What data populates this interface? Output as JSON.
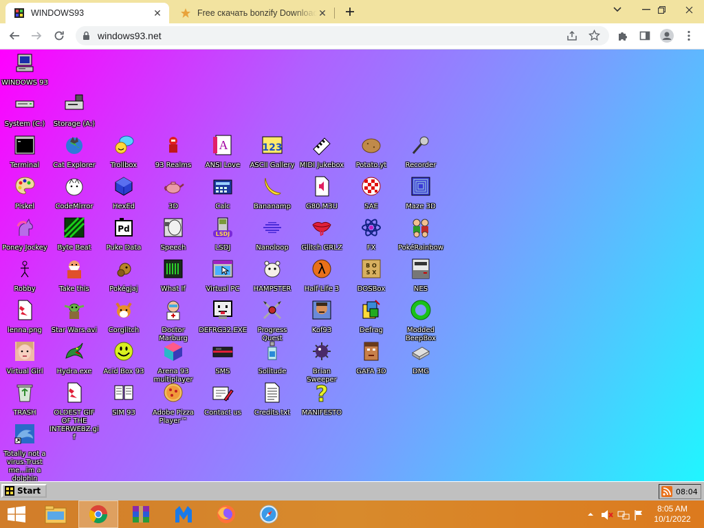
{
  "browser": {
    "tabs": [
      {
        "title": "WINDOWS93",
        "active": true
      },
      {
        "title": "Free скачать bonzify Download",
        "active": false
      }
    ],
    "url": "windows93.net"
  },
  "desktop": {
    "icons": [
      {
        "label": "WINDOWS 93",
        "icon": "computer-icon"
      },
      {
        "label": "System (C:)",
        "icon": "drive-icon"
      },
      {
        "label": "Storage (A:)",
        "icon": "floppy-drive-icon"
      },
      {
        "label": "Terminal",
        "icon": "terminal-icon"
      },
      {
        "label": "Cat Explorer",
        "icon": "cat-globe-icon"
      },
      {
        "label": "Trollbox",
        "icon": "chat-bubble-icon"
      },
      {
        "label": "93 Realms",
        "icon": "red-knight-icon"
      },
      {
        "label": "ANSI Love",
        "icon": "ansi-letter-icon"
      },
      {
        "label": "ASCII Gallery",
        "icon": "ascii-numbers-icon"
      },
      {
        "label": "MIDI Jukebox",
        "icon": "piano-keys-icon"
      },
      {
        "label": "Potato.yt",
        "icon": "potato-icon"
      },
      {
        "label": "Recorder",
        "icon": "microphone-icon"
      },
      {
        "label": "Piskel",
        "icon": "paint-palette-icon"
      },
      {
        "label": "CodeMirror",
        "icon": "code-cat-icon"
      },
      {
        "label": "HexEd",
        "icon": "blue-cube-icon"
      },
      {
        "label": "3D",
        "icon": "teapot-icon"
      },
      {
        "label": "Calc",
        "icon": "calculator-icon"
      },
      {
        "label": "Bananamp",
        "icon": "banana-icon"
      },
      {
        "label": "G80.M3U",
        "icon": "audio-file-icon"
      },
      {
        "label": "SAE",
        "icon": "amiga-ball-icon"
      },
      {
        "label": "Maze 3D",
        "icon": "maze-icon"
      },
      {
        "label": "Poney Jockey",
        "icon": "pony-icon"
      },
      {
        "label": "Byte Beat",
        "icon": "waveform-icon"
      },
      {
        "label": "Puke Data",
        "icon": "pd-icon"
      },
      {
        "label": "Speech",
        "icon": "face-speech-icon"
      },
      {
        "label": "LSDJ",
        "icon": "gameboy-icon"
      },
      {
        "label": "Nanoloop",
        "icon": "loop-wave-icon"
      },
      {
        "label": "Glitch GRLZ",
        "icon": "lips-icon"
      },
      {
        "label": "FX",
        "icon": "atom-icon"
      },
      {
        "label": "PokéRainbow",
        "icon": "trainers-icon"
      },
      {
        "label": "Robby",
        "icon": "stick-figure-icon"
      },
      {
        "label": "Take this",
        "icon": "old-man-icon"
      },
      {
        "label": "Pokégjaj",
        "icon": "pokemon-icon"
      },
      {
        "label": "What If",
        "icon": "film-strip-icon"
      },
      {
        "label": "Virtual PC",
        "icon": "window-cursor-icon"
      },
      {
        "label": "HAMPSTER",
        "icon": "hamster-icon"
      },
      {
        "label": "Half-Life 3",
        "icon": "lambda-icon"
      },
      {
        "label": "DOSBox",
        "icon": "dosbox-icon"
      },
      {
        "label": "NES",
        "icon": "nes-console-icon"
      },
      {
        "label": "lenna.png",
        "icon": "image-file-icon"
      },
      {
        "label": "Star Wars.avi",
        "icon": "yoda-icon"
      },
      {
        "label": "Corglitch",
        "icon": "corgi-icon"
      },
      {
        "label": "Doctor Marburg",
        "icon": "doctor-icon"
      },
      {
        "label": "DEFRG32.EXE",
        "icon": "monitor-face-icon"
      },
      {
        "label": "Progress Quest",
        "icon": "crossed-swords-icon"
      },
      {
        "label": "Kof93",
        "icon": "fighter-icon"
      },
      {
        "label": "Defrag",
        "icon": "defrag-icon"
      },
      {
        "label": "Modded BeepBox",
        "icon": "green-ring-icon"
      },
      {
        "label": "Virtual Girl",
        "icon": "girl-face-icon"
      },
      {
        "label": "Hydra.exe",
        "icon": "dragon-icon"
      },
      {
        "label": "Acid Box 93",
        "icon": "smiley-icon"
      },
      {
        "label": "Arena 93 multiplayer",
        "icon": "colored-cube-icon"
      },
      {
        "label": "SMS",
        "icon": "sega-console-icon"
      },
      {
        "label": "Solitude",
        "icon": "bottle-icon"
      },
      {
        "label": "Brian Sweeper",
        "icon": "mine-icon"
      },
      {
        "label": "GAFA 3D",
        "icon": "doom-guy-icon"
      },
      {
        "label": "DMG",
        "icon": "disk-image-icon"
      },
      {
        "label": "TRASH",
        "icon": "recycle-bin-icon"
      },
      {
        "label": "OLDEST GIF OF THE INTERWEBZ.gif",
        "icon": "image-file-icon"
      },
      {
        "label": "SIM 93",
        "icon": "book-icon"
      },
      {
        "label": "Adobe Pizza Player™",
        "icon": "pizza-icon"
      },
      {
        "label": "Contact us",
        "icon": "mail-pencil-icon"
      },
      {
        "label": "Credits.txt",
        "icon": "text-file-icon"
      },
      {
        "label": "MANIFESTO",
        "icon": "question-mark-icon"
      },
      {
        "label": "Totally not a virus.Trust me...im a dolphin",
        "icon": "dolphin-icon"
      }
    ],
    "taskbar": {
      "start_label": "Start",
      "clock": "08:04"
    }
  },
  "os_taskbar": {
    "apps": [
      "file-explorer-icon",
      "chrome-icon",
      "winrar-icon",
      "malwarebytes-icon",
      "firefox-icon",
      "safari-icon"
    ],
    "time": "8:05 AM",
    "date": "10/1/2022"
  }
}
